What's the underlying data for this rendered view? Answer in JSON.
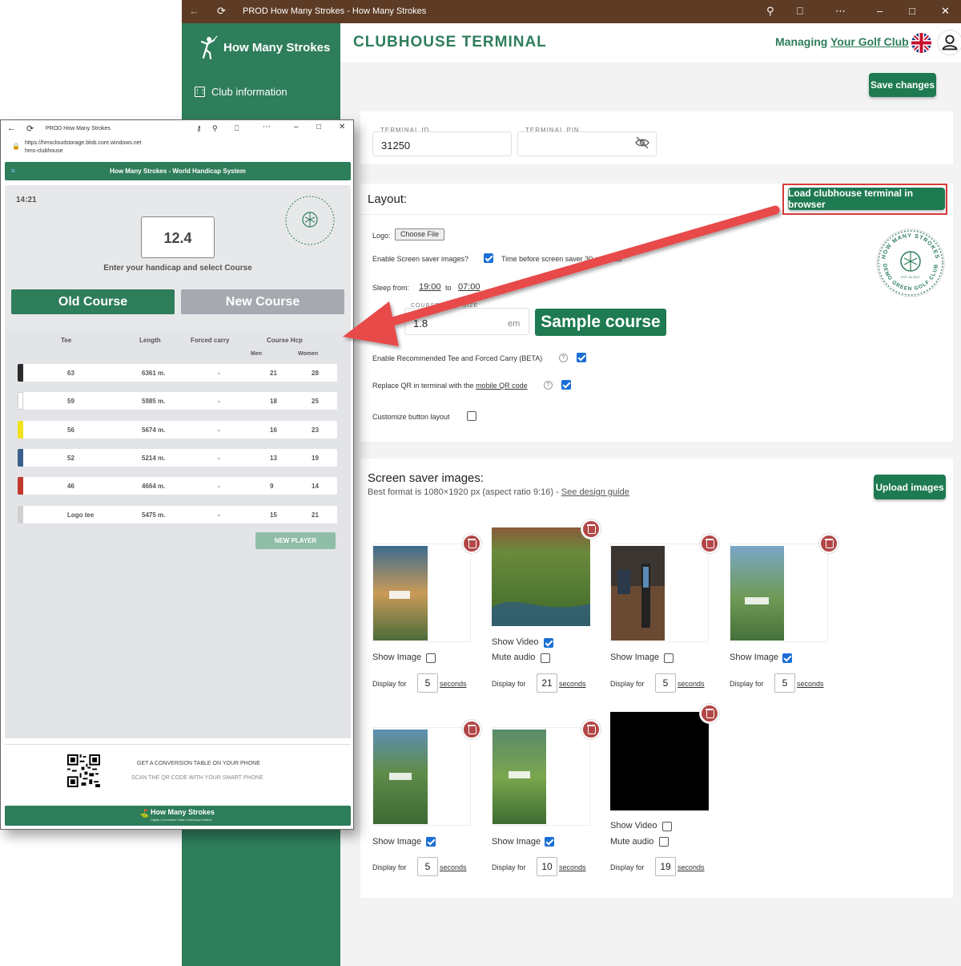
{
  "window": {
    "title": "PROD How Many Strokes - How Many Strokes"
  },
  "sidebar": {
    "brand": "How Many Strokes",
    "items": [
      {
        "label": "Club information"
      }
    ]
  },
  "header": {
    "title": "CLUBHOUSE TERMINAL",
    "managing_prefix": "Managing ",
    "managing_link": "Your Golf Club"
  },
  "toolbar": {
    "save_label": "Save changes"
  },
  "terminal": {
    "id_label": "TERMINAL ID",
    "id_value": "31250",
    "pin_label": "TERMINAL PIN",
    "pin_value": ""
  },
  "layout": {
    "title": "Layout:",
    "load_button": "Load clubhouse terminal in browser",
    "logo_label": "Logo:",
    "choose_file": "Choose File",
    "screen_saver_label": "Enable Screen saver images?",
    "screen_saver_checked": true,
    "time_before_label": "Time before screen saver",
    "time_before_value": "30",
    "time_before_unit": "seconds",
    "sleep_label": "Sleep from:",
    "sleep_from": "19:00",
    "sleep_to_label": "to",
    "sleep_to": "07:00",
    "font_size_label": "COURSE FONT SIZE",
    "font_size_value": "1.8",
    "font_size_unit": "em",
    "sample_course": "Sample course",
    "rec_tee_label": "Enable Recommended Tee and Forced Carry (BETA)",
    "rec_tee_checked": true,
    "replace_qr_prefix": "Replace QR in terminal with the ",
    "replace_qr_link": "mobile QR code",
    "replace_qr_checked": true,
    "customize_label": "Customize button layout",
    "customize_checked": false,
    "logo_text_top": "HOW MANY STROKES",
    "logo_text_bottom": "DEMO GREEN GOLF CLUB",
    "logo_est": "EST. IN 2027"
  },
  "screensavers": {
    "title": "Screen saver images:",
    "subtitle_prefix": "Best format is 1080×1920 px (aspect ratio 9:16) - ",
    "subtitle_link": "See design guide",
    "upload_button": "Upload images",
    "display_for": "Display for",
    "seconds": "seconds",
    "items": [
      {
        "kind": "image",
        "show_label": "Show Image",
        "show": false,
        "seconds": "5"
      },
      {
        "kind": "video",
        "show_label": "Show Video",
        "show": true,
        "mute_label": "Mute audio",
        "mute": false,
        "seconds": "21"
      },
      {
        "kind": "image",
        "show_label": "Show Image",
        "show": false,
        "seconds": "5"
      },
      {
        "kind": "image",
        "show_label": "Show Image",
        "show": true,
        "seconds": "5"
      },
      {
        "kind": "image",
        "show_label": "Show Image",
        "show": true,
        "seconds": "5"
      },
      {
        "kind": "image",
        "show_label": "Show Image",
        "show": true,
        "seconds": "10"
      },
      {
        "kind": "video",
        "show_label": "Show Video",
        "show": false,
        "mute_label": "Mute audio",
        "mute": false,
        "seconds": "19"
      }
    ]
  },
  "popup": {
    "title": "PROD How Many Strokes",
    "url_line1": "https://hmscloudstorage.blob.core.windows.net",
    "url_line2": "hms-clubhouse",
    "banner": "How Many Strokes - World Handicap System",
    "time": "14:21",
    "handicap": "12.4",
    "hint": "Enter your handicap and select Course",
    "old_course": "Old Course",
    "new_course": "New Course",
    "headers": {
      "tee": "Tee",
      "length": "Length",
      "forced": "Forced carry",
      "course_hcp": "Course Hcp",
      "men": "Men",
      "women": "Women"
    },
    "rows": [
      {
        "tee": "63",
        "length": "6361 m.",
        "forced": "-",
        "men": "21",
        "women": "28",
        "color": "#2b2b2b"
      },
      {
        "tee": "59",
        "length": "5985 m.",
        "forced": "-",
        "men": "18",
        "women": "25",
        "color": "#ffffff"
      },
      {
        "tee": "56",
        "length": "5674 m.",
        "forced": "-",
        "men": "16",
        "women": "23",
        "color": "#f2e21c"
      },
      {
        "tee": "52",
        "length": "5214 m.",
        "forced": "-",
        "men": "13",
        "women": "19",
        "color": "#3a5f8c"
      },
      {
        "tee": "46",
        "length": "4664 m.",
        "forced": "-",
        "men": "9",
        "women": "14",
        "color": "#c0392b"
      },
      {
        "tee": "Logo tee",
        "length": "5475 m.",
        "forced": "-",
        "men": "15",
        "women": "21",
        "color": "#d0d0d0"
      }
    ],
    "new_player": "NEW PLAYER",
    "qr_text1": "GET A CONVERSION TABLE ON YOUR PHONE",
    "qr_text2": "SCAN THE QR CODE WITH YOUR SMART PHONE",
    "footer_title": "How Many Strokes",
    "footer_sub": "Digital Conversion Table Clubhouse Edition"
  },
  "colors": {
    "brand_green": "#2e7d5b",
    "button_green": "#1e7a50",
    "titlebar_brown": "#5d3b24",
    "arrow_red": "#e8484a",
    "checkbox_blue": "#1a6fd6"
  }
}
